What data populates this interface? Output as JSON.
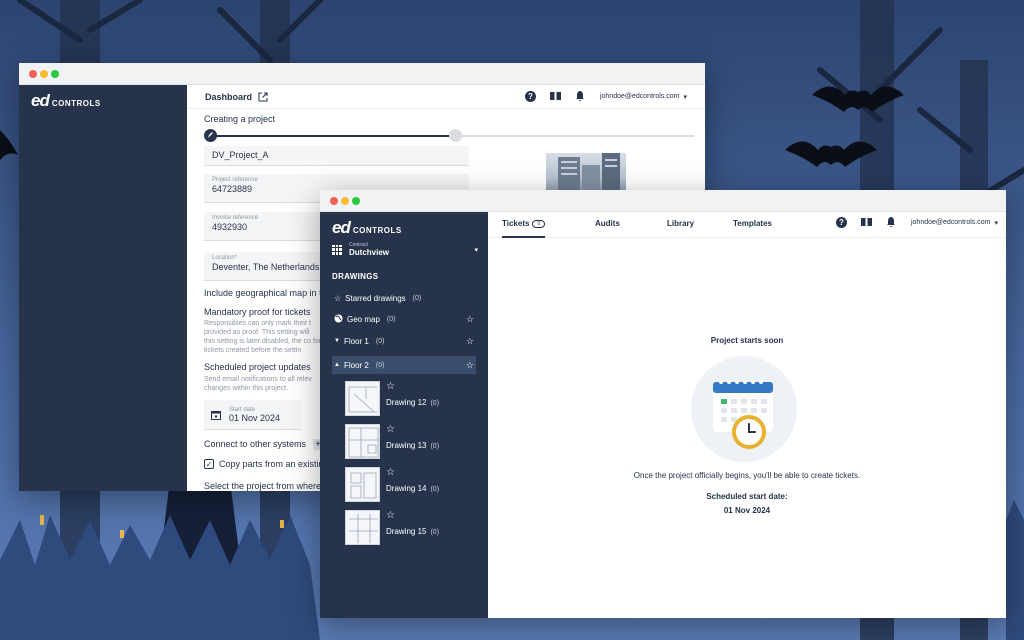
{
  "back_window": {
    "brand": {
      "ed": "ed",
      "controls": "CONTROLS"
    },
    "header": {
      "title": "Dashboard",
      "user": "johndoe@edcontrols.com"
    },
    "page_title": "Creating a project",
    "fields": {
      "name_value": "DV_Project_A",
      "reference_label": "Project reference",
      "reference_value": "64723889",
      "invoice_label": "Invoice reference",
      "invoice_value": "4932930",
      "location_label": "Location*",
      "location_value": "Deventer, The Netherlands"
    },
    "geo_map_text": "Include geographical map in th",
    "proof": {
      "title": "Mandatory proof for tickets",
      "desc": "Responsibles can only mark their t provided as proof. This setting will this setting is later disabled, the co for tickets created before the settin"
    },
    "updates": {
      "title": "Scheduled project updates",
      "desc": "Send email notifications to all relev changes within this project."
    },
    "start_date": {
      "label": "Start date",
      "value": "01 Nov 2024"
    },
    "connect_text": "Connect to other systems",
    "connect_plus": "+",
    "copy_text": "Copy parts from an existing",
    "select_text": "Select the project from where y"
  },
  "front_window": {
    "brand": {
      "ed": "ed",
      "controls": "CONTROLS"
    },
    "contract": {
      "label": "Contract",
      "value": "Dutchview"
    },
    "section_title": "DRAWINGS",
    "nav": [
      {
        "label": "Starred drawings",
        "count": "(0)"
      },
      {
        "label": "Geo map",
        "count": "(0)"
      },
      {
        "label": "Floor 1",
        "count": "(0)"
      },
      {
        "label": "Floor 2",
        "count": "(0)"
      }
    ],
    "drawings": [
      {
        "name": "Drawing 12",
        "count": "(0)"
      },
      {
        "name": "Drawing 13",
        "count": "(0)"
      },
      {
        "name": "Drawing 14",
        "count": "(0)"
      },
      {
        "name": "Drawing 15",
        "count": "(0)"
      }
    ],
    "tabs": [
      {
        "label": "Tickets",
        "badge": "0"
      },
      {
        "label": "Audits"
      },
      {
        "label": "Library"
      },
      {
        "label": "Templates"
      }
    ],
    "user": "johndoe@edcontrols.com",
    "empty": {
      "title": "Project starts soon",
      "message": "Once the project officially begins, you'll be able to create tickets.",
      "scheduled_label": "Scheduled start date:",
      "scheduled_value": "01 Nov 2024"
    },
    "colors": {
      "sidebar": "#26334a",
      "calendar": "#3578c6",
      "clock": "#e9b130",
      "accent_green": "#3dbb6b"
    }
  }
}
